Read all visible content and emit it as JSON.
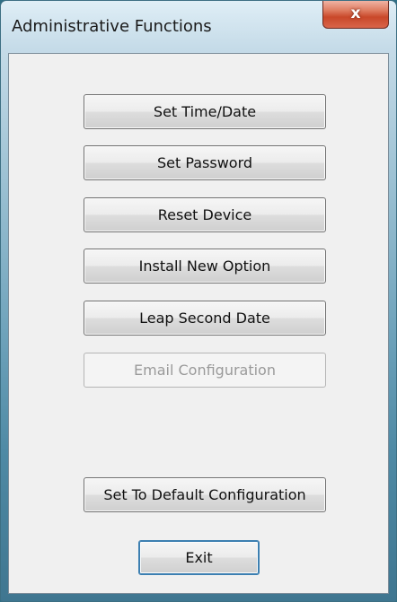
{
  "window": {
    "title": "Administrative Functions",
    "close_glyph": "x"
  },
  "buttons": {
    "set_time_date": "Set Time/Date",
    "set_password": "Set Password",
    "reset_device": "Reset Device",
    "install_new_option": "Install New Option",
    "leap_second_date": "Leap Second Date",
    "email_configuration": "Email Configuration",
    "set_default": "Set To Default Configuration",
    "exit": "Exit"
  }
}
